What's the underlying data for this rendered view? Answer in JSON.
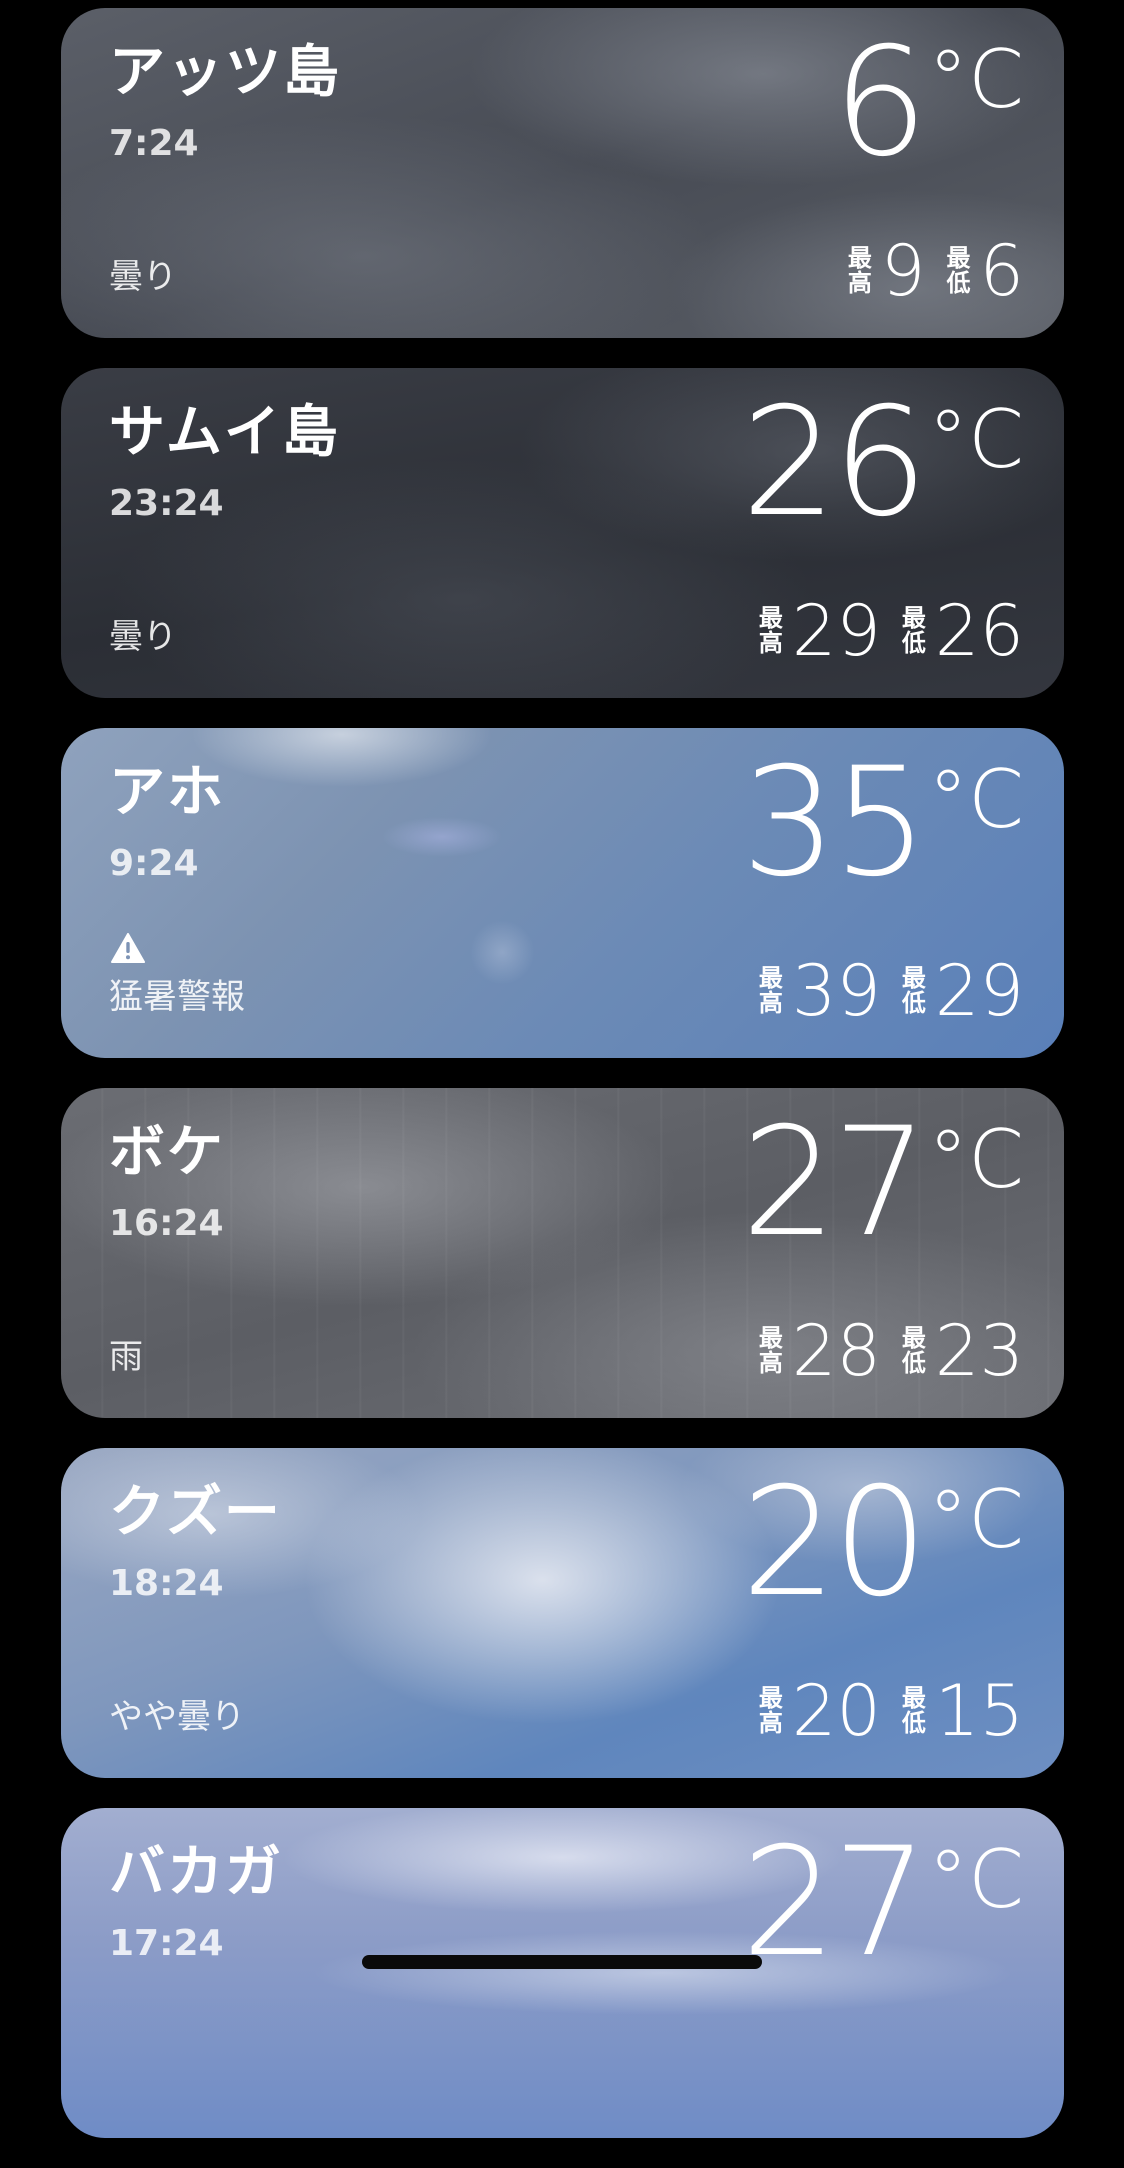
{
  "cards": [
    {
      "city": "アッツ島",
      "time": "7:24",
      "temp": "6",
      "unit": "°C",
      "condition": "曇り",
      "hi_label": "最高",
      "hi": "9",
      "lo_label": "最低",
      "lo": "6",
      "style": "cloudy-dark",
      "alert": false
    },
    {
      "city": "サムイ島",
      "time": "23:24",
      "temp": "26",
      "unit": "°C",
      "condition": "曇り",
      "hi_label": "最高",
      "hi": "29",
      "lo_label": "最低",
      "lo": "26",
      "style": "cloudy-night",
      "alert": false
    },
    {
      "city": "アホ",
      "time": "9:24",
      "temp": "35",
      "unit": "°C",
      "condition": "猛暑警報",
      "hi_label": "最高",
      "hi": "39",
      "lo_label": "最低",
      "lo": "29",
      "style": "sunny",
      "alert": true,
      "alert_icon": "warning-icon"
    },
    {
      "city": "ボケ",
      "time": "16:24",
      "temp": "27",
      "unit": "°C",
      "condition": "雨",
      "hi_label": "最高",
      "hi": "28",
      "lo_label": "最低",
      "lo": "23",
      "style": "rainy",
      "alert": false
    },
    {
      "city": "クズー",
      "time": "18:24",
      "temp": "20",
      "unit": "°C",
      "condition": "やや曇り",
      "hi_label": "最高",
      "hi": "20",
      "lo_label": "最低",
      "lo": "15",
      "style": "partly",
      "alert": false
    },
    {
      "city": "バカガ",
      "time": "17:24",
      "temp": "27",
      "unit": "°C",
      "condition": "",
      "hi_label": "",
      "hi": "",
      "lo_label": "",
      "lo": "",
      "style": "partly2",
      "alert": false
    }
  ]
}
